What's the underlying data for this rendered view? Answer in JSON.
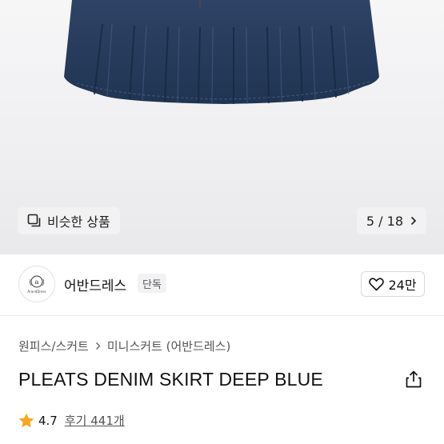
{
  "gallery": {
    "similar_label": "비슷한 상품",
    "counter": "5 / 18"
  },
  "store": {
    "name": "어반드레스",
    "badge": "단독",
    "likes": "24만",
    "logo_text": "ArandDress"
  },
  "breadcrumb": [
    "원피스/스커트",
    "미니스커트 (어반드레스)"
  ],
  "product": {
    "title": "PLEATS DENIM SKIRT DEEP BLUE",
    "rating": "4.7",
    "reviews": "후기 441개"
  },
  "colors": {
    "star": "#f5a623",
    "denim": "#253a58"
  }
}
